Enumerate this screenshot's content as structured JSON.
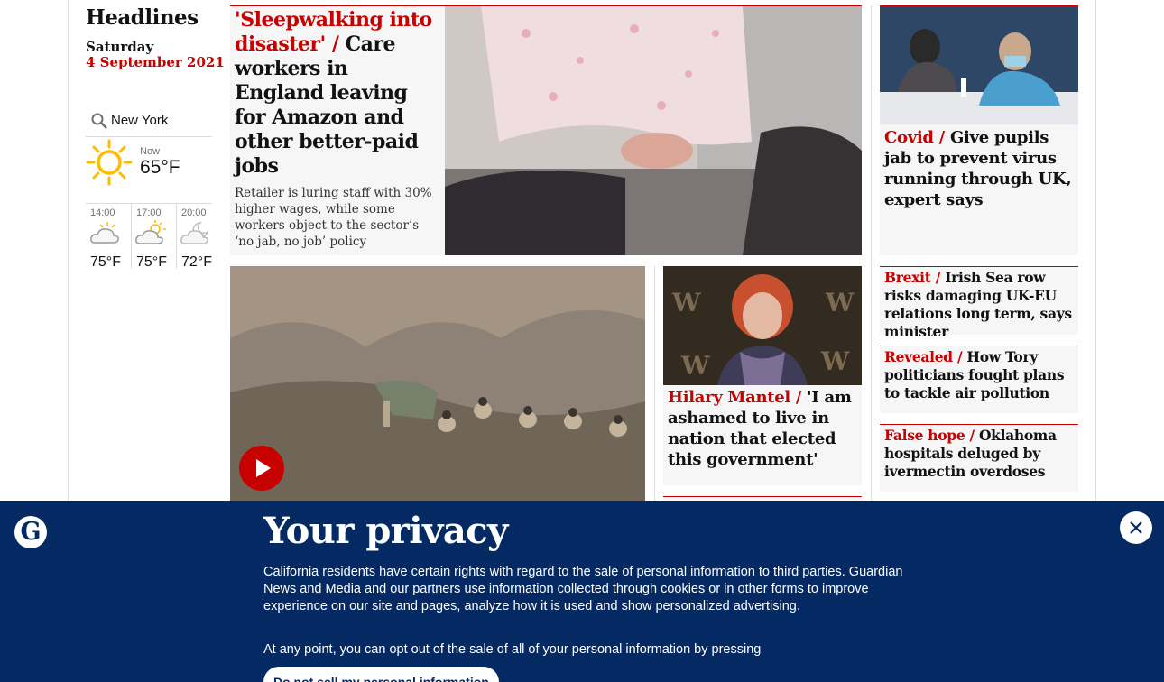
{
  "left_column": {
    "title": "Headlines",
    "day": "Saturday",
    "date": "4 September 2021"
  },
  "weather": {
    "location_value": "New York",
    "now_label": "Now",
    "now_temp": "65°F",
    "now_icon": "sun-icon",
    "forecast": [
      {
        "time": "14:00",
        "temp": "75°F",
        "icon": "cloud-icon"
      },
      {
        "time": "17:00",
        "temp": "75°F",
        "icon": "sun-cloud-icon"
      },
      {
        "time": "20:00",
        "temp": "72°F",
        "icon": "moon-cloud-icon"
      }
    ]
  },
  "stories": {
    "lead": {
      "kicker": "'Sleepwalking into disaster' /",
      "headline": "Care workers in England leaving for Amazon and other better-paid jobs",
      "standfirst": "Retailer is luring staff with 30% higher wages, while some workers object to the sector’s ‘no jab, no job’ policy"
    },
    "covid": {
      "kicker": "Covid /",
      "headline": "Give pupils jab to prevent virus running through UK, expert says"
    },
    "mantel": {
      "kicker": "Hilary Mantel /",
      "headline": "'I am ashamed to live in nation that elected this government'"
    },
    "brexit": {
      "kicker": "Brexit /",
      "headline": "Irish Sea row risks damaging UK-EU relations long term, says minister"
    },
    "revealed": {
      "kicker": "Revealed /",
      "headline": "How Tory politicians fought plans to tackle air pollution"
    },
    "falsehope": {
      "kicker": "False hope /",
      "headline": "Oklahoma hospitals deluged by ivermectin overdoses"
    }
  },
  "privacy": {
    "title": "Your privacy",
    "body": "California residents have certain rights with regard to the sale of personal information to third parties. Guardian News and Media and our partners use information collected through cookies or in other forms to improve experience on our site and pages, analyze how it is used and show personalized advertising.",
    "optout_text": "At any point, you can opt out of the sale of all of your personal information by pressing",
    "button_label": "Do not sell my personal information",
    "logo_letter": "G"
  },
  "colors": {
    "accent": "#c70000",
    "banner": "#052962",
    "card_bg": "#f6f6f6"
  }
}
